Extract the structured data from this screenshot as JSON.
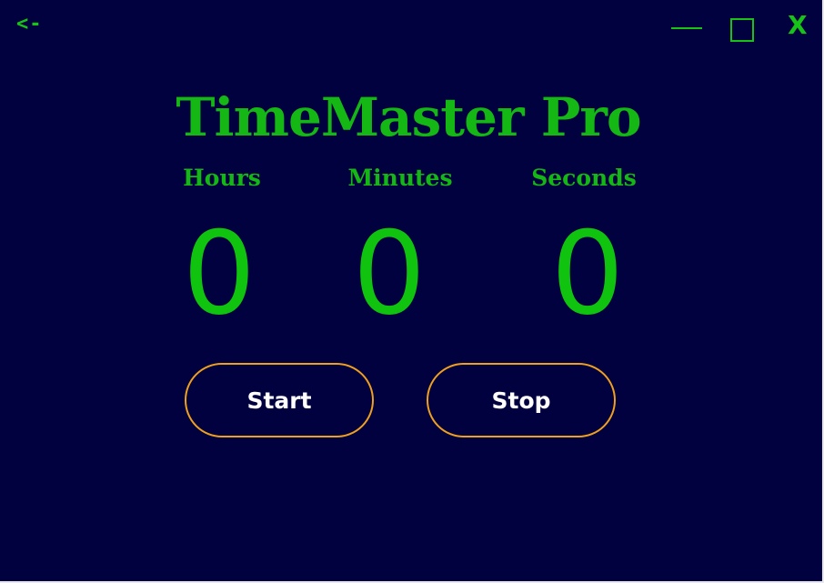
{
  "window": {
    "back_label": "<-",
    "close_label": "X",
    "controls": [
      "minimize-icon",
      "maximize-icon",
      "close-icon"
    ]
  },
  "app": {
    "title": "TimeMaster Pro"
  },
  "timer": {
    "labels": {
      "hours": "Hours",
      "minutes": "Minutes",
      "seconds": "Seconds"
    },
    "values": {
      "hours": "0",
      "minutes": "0",
      "seconds": "0"
    }
  },
  "buttons": {
    "start_label": "Start",
    "stop_label": "Stop"
  },
  "colors": {
    "background": "#01013f",
    "accent_green": "#14b714",
    "button_border": "#f0a020",
    "button_text": "#ffffff"
  }
}
